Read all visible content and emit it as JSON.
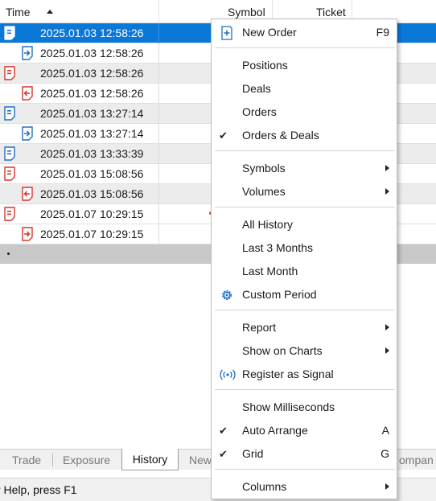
{
  "table": {
    "columns": {
      "time": "Time",
      "symbol": "Symbol",
      "ticket": "Ticket"
    },
    "rows": [
      {
        "time": "2025.01.03 12:58:26",
        "icon": "order-blue-icon",
        "level": 0,
        "selected": true
      },
      {
        "time": "2025.01.03 12:58:26",
        "icon": "deal-in-blue-icon",
        "level": 1
      },
      {
        "time": "2025.01.03 12:58:26",
        "icon": "order-red-icon",
        "level": 0
      },
      {
        "time": "2025.01.03 12:58:26",
        "icon": "deal-out-red-icon",
        "level": 1
      },
      {
        "time": "2025.01.03 13:27:14",
        "icon": "order-blue-icon",
        "level": 0
      },
      {
        "time": "2025.01.03 13:27:14",
        "icon": "deal-in-blue-icon",
        "level": 1
      },
      {
        "time": "2025.01.03 13:33:39",
        "icon": "order-blue-icon",
        "level": 0
      },
      {
        "time": "2025.01.03 15:08:56",
        "icon": "order-red-icon",
        "level": 0
      },
      {
        "time": "2025.01.03 15:08:56",
        "icon": "deal-out-red-icon",
        "level": 1
      },
      {
        "time": "2025.01.07 10:29:15",
        "icon": "order-red-icon",
        "level": 0
      },
      {
        "time": "2025.01.07 10:29:15",
        "icon": "deal-in-red-icon",
        "level": 1
      }
    ]
  },
  "tabs": {
    "trade": "Trade",
    "exposure": "Exposure",
    "history": "History",
    "news": "New",
    "company": "ompan"
  },
  "status": {
    "help": "r Help, press F1"
  },
  "menu": {
    "new_order": {
      "label": "New Order",
      "shortcut": "F9",
      "icon": "new-order-icon"
    },
    "positions": "Positions",
    "deals": "Deals",
    "orders": "Orders",
    "orders_deals": {
      "label": "Orders & Deals",
      "checked": true
    },
    "symbols": "Symbols",
    "volumes": "Volumes",
    "all_history": "All History",
    "last_3_months": "Last 3 Months",
    "last_month": "Last Month",
    "custom_period": {
      "label": "Custom Period",
      "icon": "gear-icon"
    },
    "report": "Report",
    "show_on_charts": "Show on Charts",
    "register_signal": {
      "label": "Register as Signal",
      "icon": "broadcast-icon"
    },
    "show_ms": "Show Milliseconds",
    "auto_arrange": {
      "label": "Auto Arrange",
      "shortcut": "A",
      "checked": true
    },
    "grid": {
      "label": "Grid",
      "shortcut": "G",
      "checked": true
    },
    "columns": "Columns",
    "check_glyph": "✔"
  },
  "colors": {
    "selection": "#0a78d7",
    "blue_icon": "#1f6fc5",
    "red_icon": "#d9352b"
  }
}
